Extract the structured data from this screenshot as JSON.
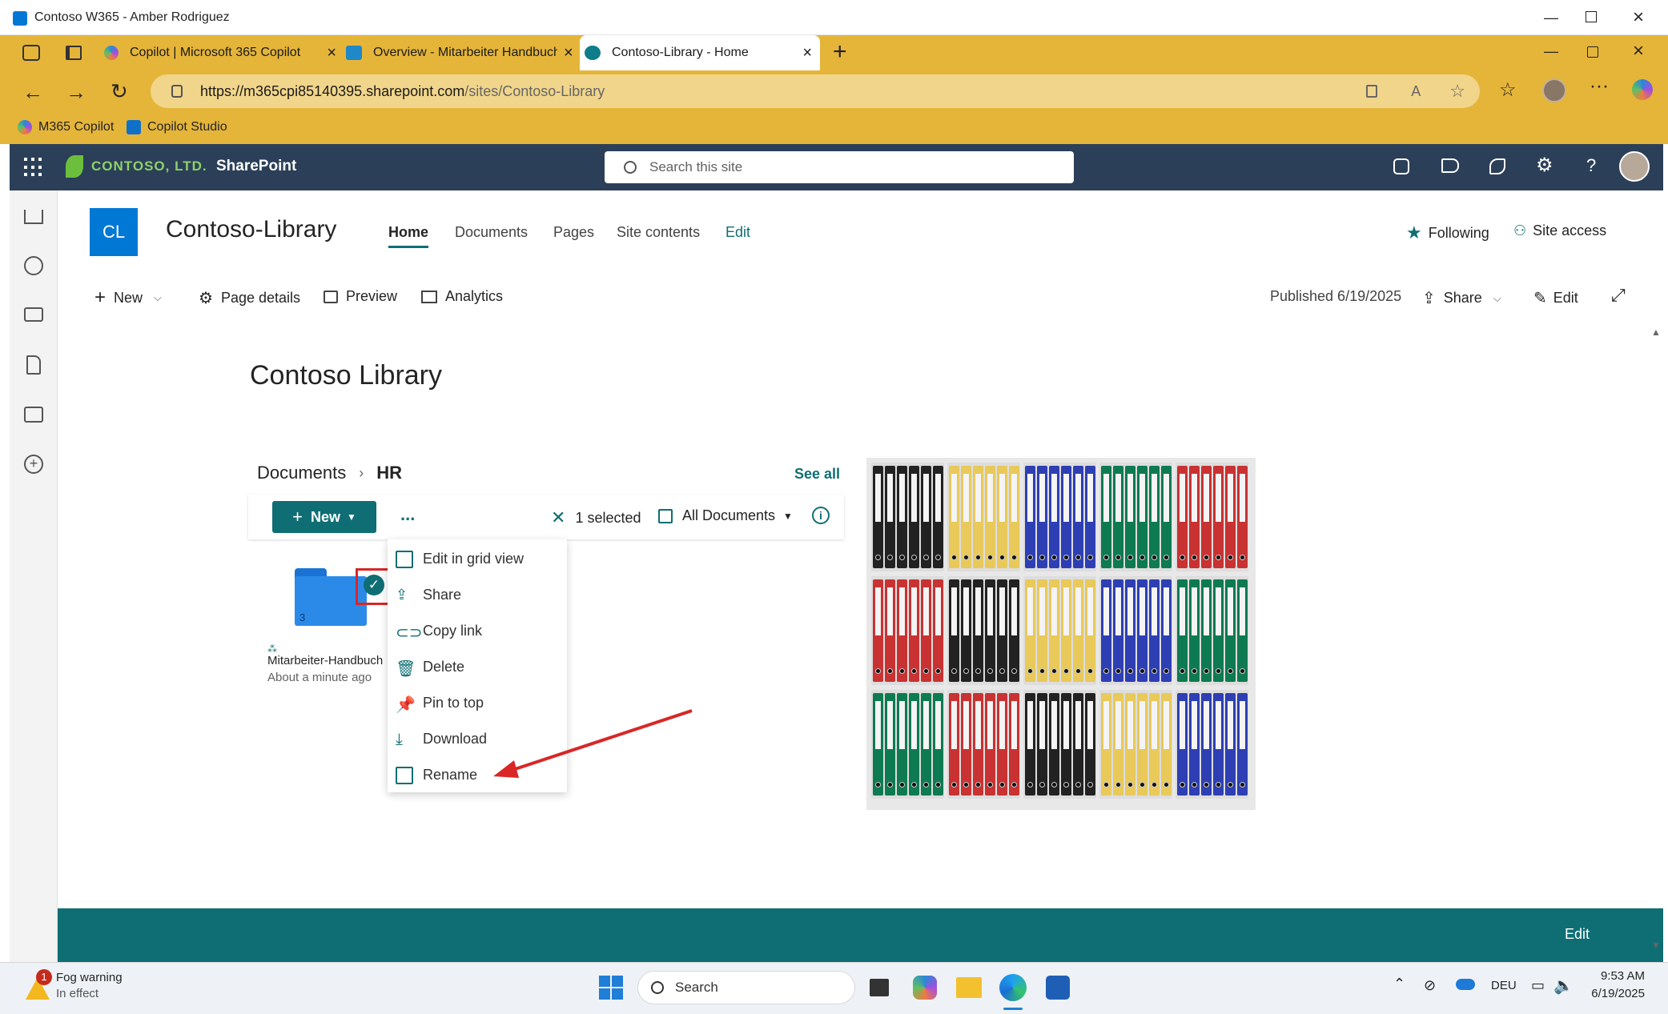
{
  "window": {
    "title": "Contoso W365 - Amber Rodriguez"
  },
  "tabs": [
    {
      "label": "Copilot | Microsoft 365 Copilot"
    },
    {
      "label": "Overview - Mitarbeiter Handbuch"
    },
    {
      "label": "Contoso-Library - Home"
    }
  ],
  "address": {
    "url_host": "https://m365cpi85140395.sharepoint.com",
    "url_path": "/sites/Contoso-Library"
  },
  "favorites": [
    {
      "label": "M365 Copilot"
    },
    {
      "label": "Copilot Studio"
    }
  ],
  "suitebar": {
    "org": "CONTOSO, LTD.",
    "app": "SharePoint",
    "search_placeholder": "Search this site"
  },
  "site": {
    "logo": "CL",
    "title": "Contoso-Library",
    "nav": [
      "Home",
      "Documents",
      "Pages",
      "Site contents",
      "Edit"
    ],
    "following": "Following",
    "site_access": "Site access"
  },
  "commandbar": {
    "new": "New",
    "page_details": "Page details",
    "preview": "Preview",
    "analytics": "Analytics",
    "published": "Published 6/19/2025",
    "share": "Share",
    "edit": "Edit"
  },
  "page": {
    "heading": "Contoso Library"
  },
  "doclib": {
    "breadcrumb_root": "Documents",
    "breadcrumb_current": "HR",
    "see_all": "See all",
    "new": "New",
    "more": "...",
    "selected": "1 selected",
    "view": "All Documents"
  },
  "folder": {
    "name": "Mitarbeiter-Handbuch",
    "modified": "About a minute ago",
    "count": "3"
  },
  "context_menu": [
    "Edit in grid view",
    "Share",
    "Copy link",
    "Delete",
    "Pin to top",
    "Download",
    "Rename"
  ],
  "footer": {
    "edit": "Edit"
  },
  "taskbar": {
    "weather_title": "Fog warning",
    "weather_sub": "In effect",
    "weather_badge": "1",
    "search": "Search",
    "lang": "DEU",
    "time": "9:53 AM",
    "date": "6/19/2025"
  },
  "colors": {
    "tab_bar": "#e5b53a",
    "suite_bar": "#2b3f58",
    "accent": "#0f6e74",
    "logo_tile": "#0078d4",
    "annotation": "#d92626"
  }
}
